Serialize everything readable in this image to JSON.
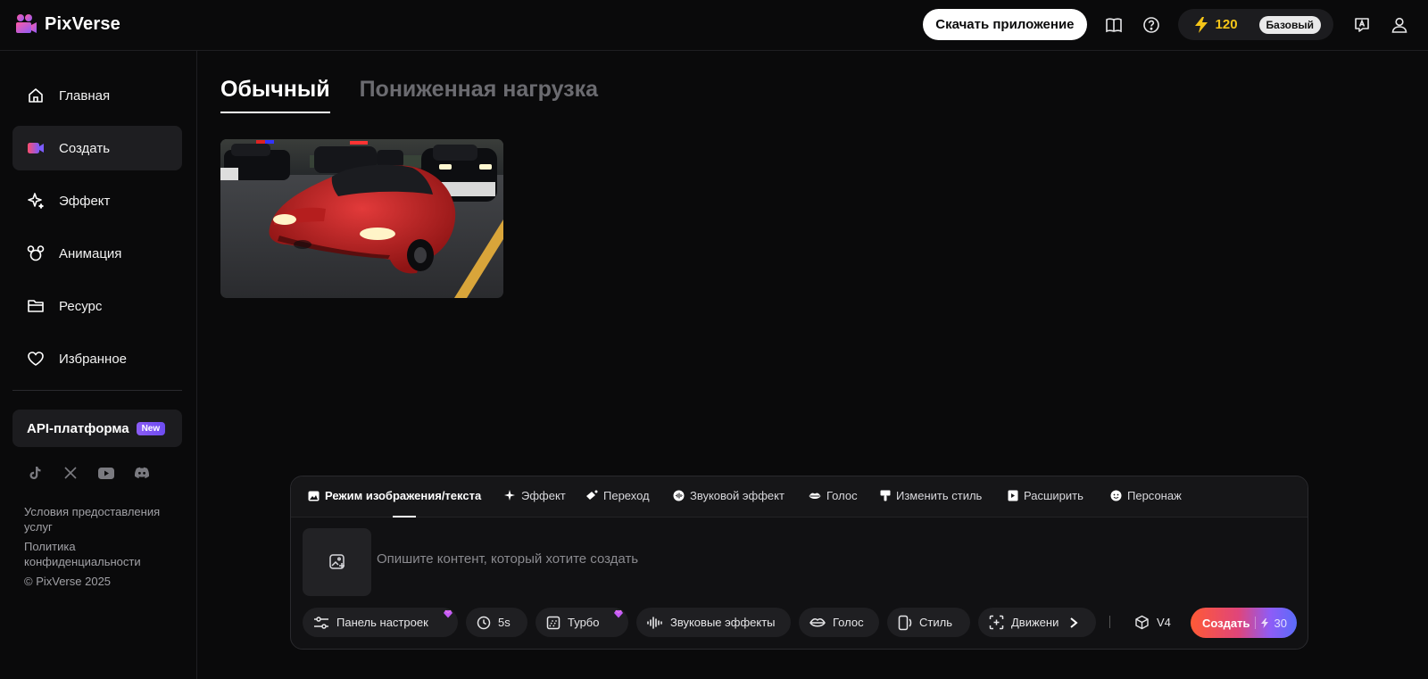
{
  "brand": {
    "name": "PixVerse"
  },
  "header": {
    "download_label": "Скачать приложение",
    "credits": "120",
    "plan": "Базовый"
  },
  "sidebar": {
    "items": [
      {
        "label": "Главная",
        "icon": "home-icon"
      },
      {
        "label": "Создать",
        "icon": "video-camera-icon",
        "active": true
      },
      {
        "label": "Эффект",
        "icon": "sparkle-icon"
      },
      {
        "label": "Анимация",
        "icon": "mouse-head-icon"
      },
      {
        "label": "Ресурс",
        "icon": "folder-icon"
      },
      {
        "label": "Избранное",
        "icon": "heart-icon"
      }
    ],
    "api": {
      "label": "API-платформа",
      "badge": "New"
    },
    "footer": {
      "terms": "Условия предоставления услуг",
      "privacy": "Политика конфиденциальности",
      "copyright": "© PixVerse 2025"
    }
  },
  "main": {
    "tabs": [
      {
        "label": "Обычный",
        "active": true
      },
      {
        "label": "Пониженная нагрузка",
        "active": false
      }
    ]
  },
  "composer": {
    "mode_tabs": [
      "Режим изображения/текста",
      "Эффект",
      "Переход",
      "Звуковой эффект",
      "Голос",
      "Изменить стиль",
      "Расширить",
      "Персонаж"
    ],
    "prompt_placeholder": "Опишите контент, который хотите создать",
    "options": {
      "settings": "Панель настроек",
      "duration": "5s",
      "turbo": "Турбо",
      "sound": "Звуковые эффекты",
      "voice": "Голос",
      "style": "Стиль",
      "motion": "Движени"
    },
    "model": "V4",
    "create_label": "Создать",
    "create_cost": "30"
  },
  "colors": {
    "accent_gold": "#f5c518",
    "bg": "#0a0a0b",
    "panel": "#1c1c1f"
  }
}
